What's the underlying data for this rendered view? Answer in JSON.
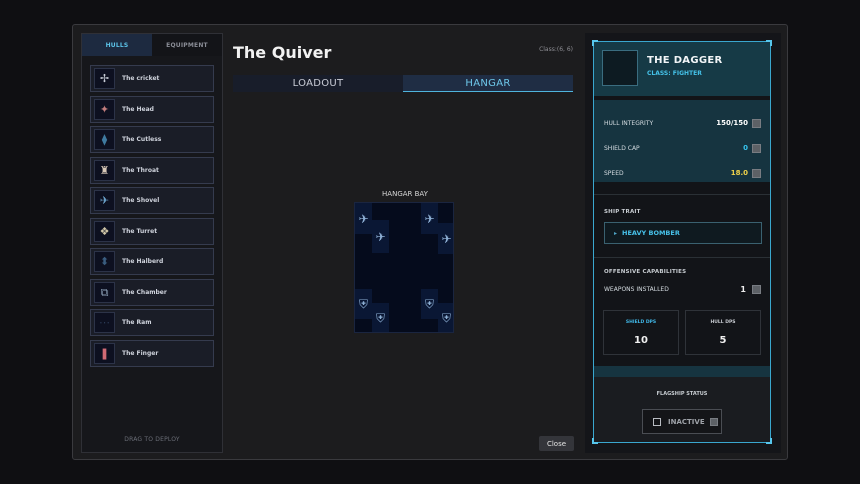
{
  "left": {
    "tabs": [
      {
        "label": "HULLS"
      },
      {
        "label": "EQUIPMENT"
      }
    ],
    "hulls": [
      {
        "name": "The cricket",
        "icon": "cricket-ship-icon",
        "glyph": "✢",
        "color": "#c7ccd6"
      },
      {
        "name": "The Head",
        "icon": "head-ship-icon",
        "glyph": "✦",
        "color": "#c07c7c"
      },
      {
        "name": "The Cutless",
        "icon": "cutless-ship-icon",
        "glyph": "⧫",
        "color": "#3f7aa0"
      },
      {
        "name": "The Throat",
        "icon": "throat-ship-icon",
        "glyph": "♜",
        "color": "#d8c8b8"
      },
      {
        "name": "The Shovel",
        "icon": "shovel-ship-icon",
        "glyph": "✈",
        "color": "#6aa0c8"
      },
      {
        "name": "The Turret",
        "icon": "turret-ship-icon",
        "glyph": "❖",
        "color": "#d0c6a8"
      },
      {
        "name": "The Halberd",
        "icon": "halberd-ship-icon",
        "glyph": "⬍",
        "color": "#3a5d80"
      },
      {
        "name": "The Chamber",
        "icon": "chamber-ship-icon",
        "glyph": "⧉",
        "color": "#8a9eb3"
      },
      {
        "name": "The Ram",
        "icon": "ram-ship-icon",
        "glyph": "⋯",
        "color": "#2a3a55"
      },
      {
        "name": "The Finger",
        "icon": "finger-ship-icon",
        "glyph": "❚",
        "color": "#d06a74"
      }
    ],
    "deploy_hint": "DRAG TO DEPLOY"
  },
  "center": {
    "title": "The Quiver",
    "class_coord": "Class:(6, 6)",
    "tabs": [
      {
        "label": "LOADOUT",
        "active": false
      },
      {
        "label": "HANGAR",
        "active": true
      }
    ],
    "bay_label": "HANGAR BAY",
    "close_label": "Close"
  },
  "card": {
    "ship_name": "THE DAGGER",
    "ship_class": "CLASS: FIGHTER",
    "stats": [
      {
        "label": "HULL INTEGRITY",
        "value": "150/150",
        "color": "#ffffff"
      },
      {
        "label": "SHIELD CAP",
        "value": "0",
        "color": "#37c5ef"
      },
      {
        "label": "SPEED",
        "value": "18.0",
        "color": "#f0d24a"
      }
    ],
    "trait_label": "SHIP TRAIT",
    "trait_value": "HEAVY BOMBER",
    "offensive_label": "OFFENSIVE CAPABILITIES",
    "weapons_label": "WEAPONS INSTALLED",
    "weapons_value": "1",
    "shield_dps_label": "SHIELD DPS",
    "shield_dps_value": "10",
    "shield_dps_color": "#40b8e8",
    "hull_dps_label": "HULL DPS",
    "hull_dps_value": "5",
    "hull_dps_color": "#c9cdd3",
    "flagship_label": "FLAGSHIP STATUS",
    "flagship_value": "INACTIVE"
  },
  "colors": {
    "accent": "#3aa7cf",
    "background": "#0f0f12"
  }
}
